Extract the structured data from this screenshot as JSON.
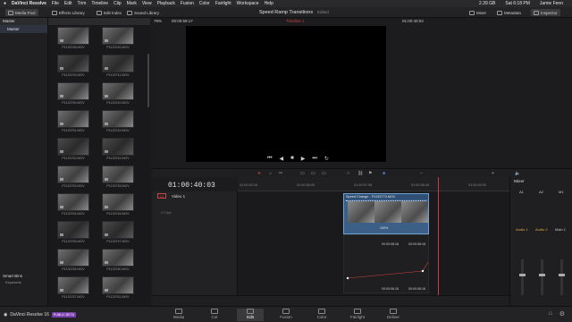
{
  "menubar": {
    "items": [
      "DaVinci Resolve",
      "File",
      "Edit",
      "Trim",
      "Timeline",
      "Clip",
      "Mark",
      "View",
      "Playback",
      "Fusion",
      "Color",
      "Fairlight",
      "Workspace",
      "Help"
    ],
    "battery": "2.39 GB",
    "clock": "Sat 6:18 PM",
    "user": "Jamie Fenn"
  },
  "toolbar": {
    "media_pool": "Media Pool",
    "effects_library": "Effects Library",
    "edit_index": "Edit Index",
    "sound_library": "Sound Library",
    "project_title": "Speed Ramp Transitions",
    "edited": "Edited",
    "mixer": "Mixer",
    "metadata": "Metadata",
    "inspector": "Inspector"
  },
  "sidebar": {
    "header": "Master",
    "bin": "Master",
    "smart_bins": "Smart Bins",
    "keywords": "Keywords"
  },
  "pool": {
    "clips_left": [
      "P1133748.MOV",
      "P1133749.MOV",
      "P1133750.MOV",
      "P1133751.MOV",
      "P1133752.MOV",
      "P1133753.MOV",
      "P1133754.MOV",
      "P1133755.MOV",
      "P1133756.MOV",
      "P1133757.MOV"
    ],
    "clips_right": [
      "P1133740.MOV",
      "P1133741.MOV",
      "P1133742.MOV",
      "P1133743.MOV",
      "P1133744.MOV",
      "P1133745.MOV",
      "P1133746.MOV",
      "P1133747.MOV",
      "P1133760.MOV",
      "P1133761.MOV"
    ]
  },
  "viewer": {
    "zoom": "79%",
    "source_tc": "00:00:59:17",
    "timeline_name": "Timeline 1",
    "record_tc": "01:00:40:03"
  },
  "timeline": {
    "timecode": "01:00:40:03",
    "ruler": [
      "01:00:32:16",
      "01:00:36:00",
      "01:00:37:08",
      "01:00:38:16",
      "01:00:40:00",
      "01:00:41:08"
    ],
    "track_badge": "V1",
    "track_name": "Video 1",
    "clip_count": "2 Clips",
    "clip_title": "Speed Change - P1133773.MOV",
    "speed_pct": "100%",
    "curve_tc_a": "00:00:08:18",
    "curve_tc_b": "00:00:08:18",
    "curve_tc_c": "00:00:06:18",
    "curve_tc_d": "00:00:08:18"
  },
  "mixer": {
    "title": "Mixer",
    "cols": [
      "A1",
      "A2",
      "M1"
    ],
    "names": [
      "Audio 1",
      "Audio 2",
      "Main 1"
    ]
  },
  "pages": [
    "Media",
    "Cut",
    "Edit",
    "Fusion",
    "Color",
    "Fairlight",
    "Deliver"
  ],
  "brand": {
    "name": "DaVinci Resolve 16",
    "badge": "PUBLIC BETA"
  }
}
